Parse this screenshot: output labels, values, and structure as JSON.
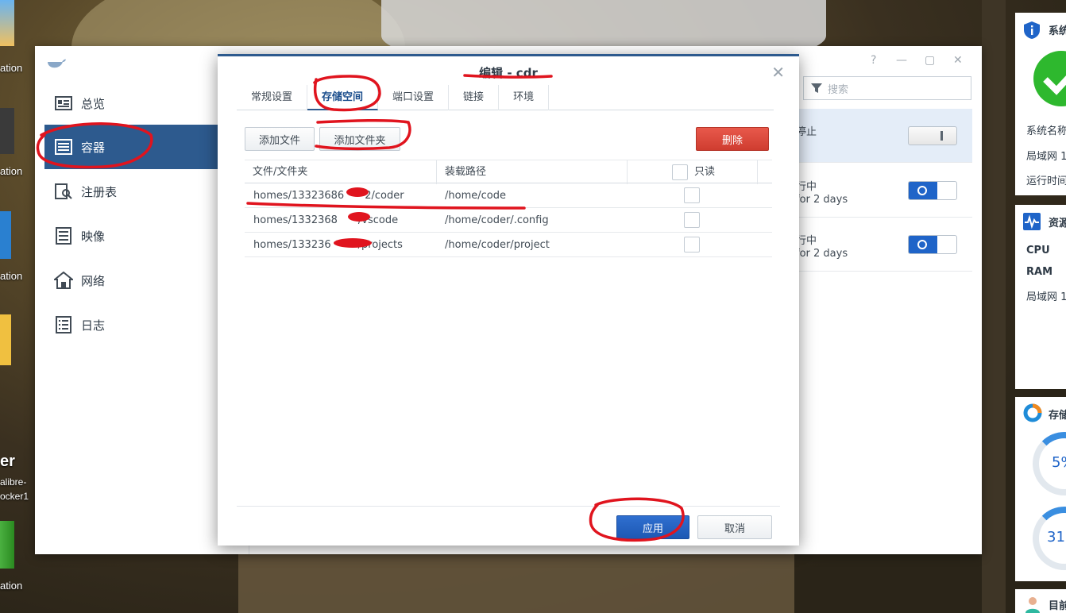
{
  "desktop": {
    "labels": [
      "ation",
      "ation",
      "ation",
      "er",
      "alibre-",
      "ocker1",
      "ation"
    ]
  },
  "main_window": {
    "controls": [
      "?",
      "—",
      "▢",
      "✕"
    ],
    "nav": [
      {
        "label": "总览",
        "icon": "overview-icon"
      },
      {
        "label": "容器",
        "icon": "container-icon"
      },
      {
        "label": "注册表",
        "icon": "registry-icon"
      },
      {
        "label": "映像",
        "icon": "image-icon"
      },
      {
        "label": "网络",
        "icon": "network-icon"
      },
      {
        "label": "日志",
        "icon": "log-icon"
      }
    ],
    "search_placeholder": "搜索",
    "rows": [
      {
        "status": "停止",
        "sub": ""
      },
      {
        "status": "行中",
        "sub": "for 2 days"
      },
      {
        "status": "行中",
        "sub": "for 2 days"
      }
    ]
  },
  "dialog": {
    "title": "编辑 - cdr",
    "close": "✕",
    "tabs": [
      "常规设置",
      "存储空间",
      "端口设置",
      "链接",
      "环境"
    ],
    "add_file": "添加文件",
    "add_folder": "添加文件夹",
    "delete": "删除",
    "columns": [
      "文件/文件夹",
      "装载路径",
      "只读"
    ],
    "rows": [
      {
        "file": "homes/13323686",
        "file_end": "2/coder",
        "mount": "/home/code"
      },
      {
        "file": "homes/1332368",
        "file_end": "/vscode",
        "mount": "/home/coder/.config"
      },
      {
        "file": "homes/133236",
        "file_end": "/projects",
        "mount": "/home/coder/project"
      }
    ],
    "apply": "应用",
    "cancel": "取消"
  },
  "right_panel": {
    "sys_title": "系统",
    "sys_name": "系统名称",
    "lan": "局域网 1",
    "uptime": "运行时间",
    "res_title": "资源",
    "cpu": "CPU",
    "ram": "RAM",
    "lan2": "局域网 1",
    "storage_title": "存储",
    "gauge1": "5%",
    "gauge2": "31",
    "current": "目前"
  },
  "colors": {
    "accent": "#2d5a8e",
    "danger": "#d9453a",
    "primary": "#1f64c8",
    "annotation": "#e0141e"
  }
}
